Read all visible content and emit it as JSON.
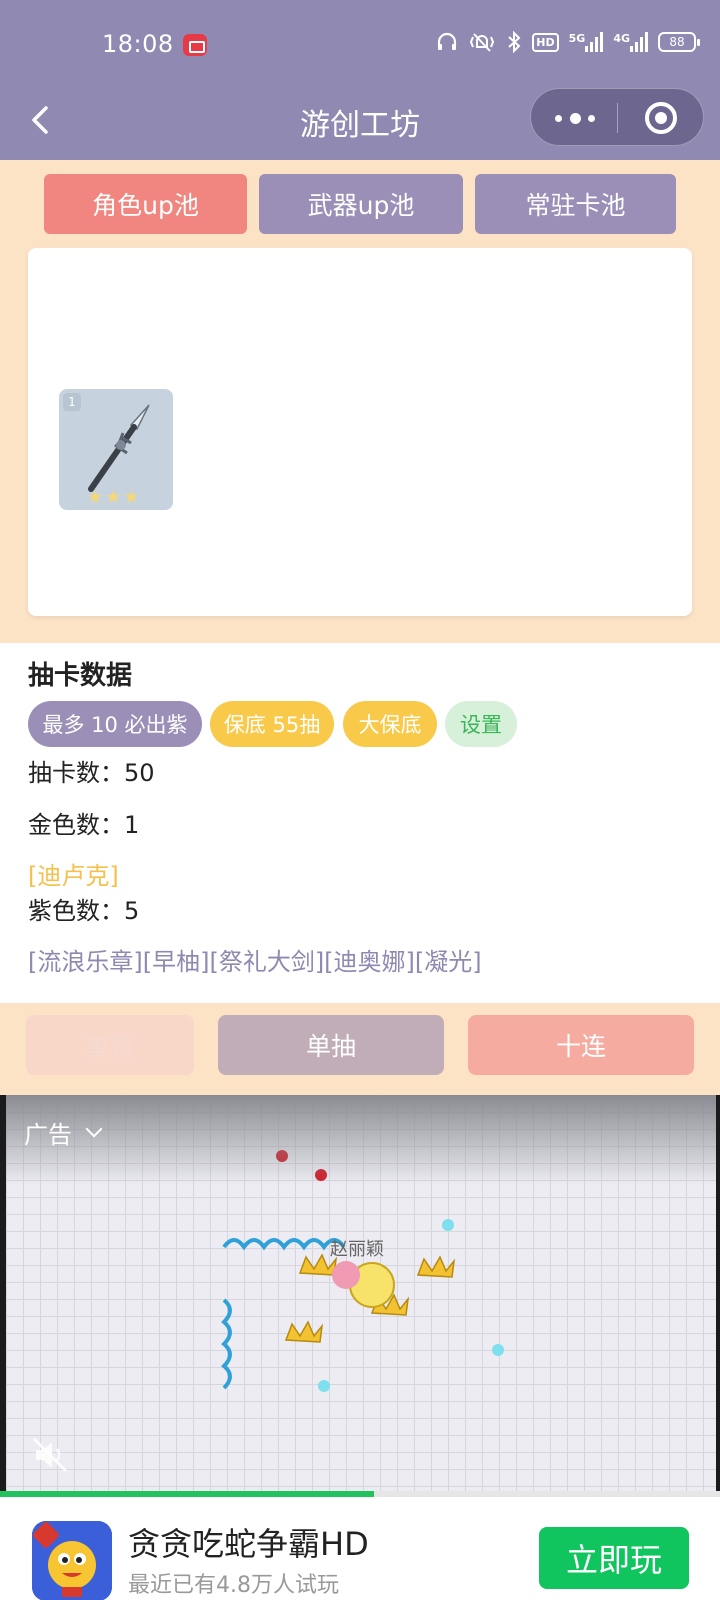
{
  "status_bar": {
    "time": "18:08",
    "icons": [
      "screen-record-icon",
      "headset-icon",
      "vibrate-icon",
      "bluetooth-icon",
      "hd-icon",
      "signal-5g-icon",
      "signal-4g-icon",
      "battery-icon"
    ],
    "hd_label": "HD",
    "net1": "5G",
    "net2": "4G",
    "battery": "88"
  },
  "nav": {
    "title": "游创工坊"
  },
  "tabs": [
    {
      "label": "角色up池",
      "active": true
    },
    {
      "label": "武器up池",
      "active": false
    },
    {
      "label": "常驻卡池",
      "active": false
    }
  ],
  "result": {
    "card_count_badge": "1",
    "card_stars": 3
  },
  "stats": {
    "title": "抽卡数据",
    "pills": {
      "max": "最多 10 必出紫",
      "pity": "保底 55抽",
      "big_pity": "大保底",
      "settings": "设置"
    },
    "draws_line": "抽卡数：50",
    "gold_line": "金色数：1",
    "gold_items": "[迪卢克]",
    "purple_line": "紫色数：5",
    "purple_items": "[流浪乐章][早柚][祭礼大剑][迪奥娜][凝光]"
  },
  "buttons": {
    "reset": "重置",
    "single": "单抽",
    "ten": "十连"
  },
  "ad": {
    "label": "广告",
    "scene_name": "赵丽颖",
    "progress": 0.52,
    "app_name": "贪贪吃蛇争霸HD",
    "app_sub": "最近已有4.8万人试玩",
    "play_label": "立即玩"
  },
  "colors": {
    "header": "#9089b2",
    "peach": "#fde3c6",
    "tab_active": "#f0867f",
    "tab_inactive": "#9b8fb7",
    "gold": "#f6c04c",
    "purple": "#8f89b1",
    "play_green": "#10c45e"
  }
}
